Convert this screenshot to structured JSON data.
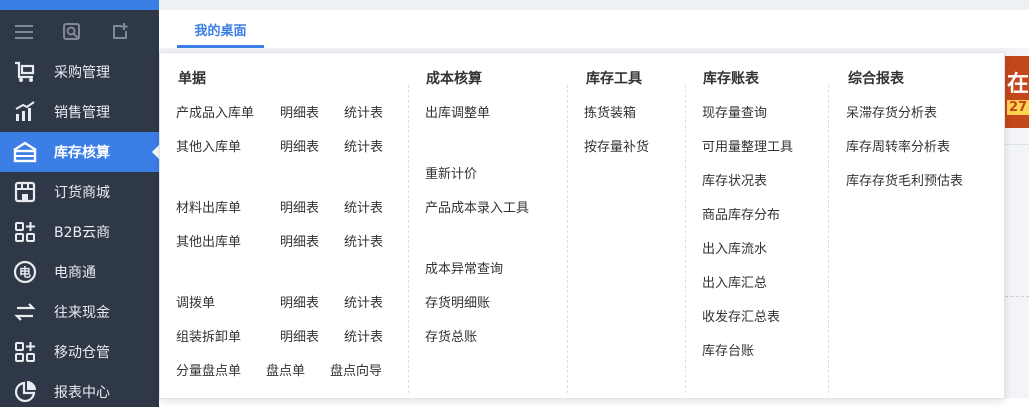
{
  "sidebar": {
    "tools": [
      {
        "icon": "hamburger-menu-icon"
      },
      {
        "icon": "search-doc-icon"
      },
      {
        "icon": "new-doc-icon"
      }
    ],
    "items": [
      {
        "label": "采购管理",
        "icon": "cart-icon"
      },
      {
        "label": "销售管理",
        "icon": "bar-chart-icon"
      },
      {
        "label": "库存核算",
        "icon": "inventory-icon",
        "active": true
      },
      {
        "label": "订货商城",
        "icon": "store-icon"
      },
      {
        "label": "B2B云商",
        "icon": "grid-plus-icon"
      },
      {
        "label": "电商通",
        "icon": "ecommerce-icon"
      },
      {
        "label": "往来现金",
        "icon": "exchange-icon"
      },
      {
        "label": "移动仓管",
        "icon": "grid-plus-icon"
      },
      {
        "label": "报表中心",
        "icon": "pie-chart-icon"
      }
    ]
  },
  "header": {
    "tab_label": "我的桌面"
  },
  "background": {
    "red_text_1": "在",
    "red_text_2": "27"
  },
  "dropdown": {
    "columns": [
      {
        "title": "单据",
        "rows": [
          [
            "产成品入库单",
            "明细表",
            "统计表"
          ],
          [
            "其他入库单",
            "明细表",
            "统计表"
          ],
          [
            "材料出库单",
            "明细表",
            "统计表"
          ],
          [
            "其他出库单",
            "明细表",
            "统计表"
          ],
          [
            "调拨单",
            "明细表",
            "统计表"
          ],
          [
            "组装拆卸单",
            "明细表",
            "统计表"
          ],
          [
            "分量盘点单",
            "盘点单",
            "盘点向导"
          ]
        ]
      },
      {
        "title": "成本核算",
        "items": [
          "出库调整单",
          "重新计价",
          "产品成本录入工具",
          "成本异常查询",
          "存货明细账",
          "存货总账"
        ]
      },
      {
        "title": "库存工具",
        "items": [
          "拣货装箱",
          "按存量补货"
        ]
      },
      {
        "title": "库存账表",
        "items": [
          "现存量查询",
          "可用量整理工具",
          "库存状况表",
          "商品库存分布",
          "出入库流水",
          "出入库汇总",
          "收发存汇总表",
          "库存台账"
        ]
      },
      {
        "title": "综合报表",
        "items": [
          "呆滞存货分析表",
          "库存周转率分析表",
          "库存存货毛利预估表"
        ]
      }
    ]
  }
}
